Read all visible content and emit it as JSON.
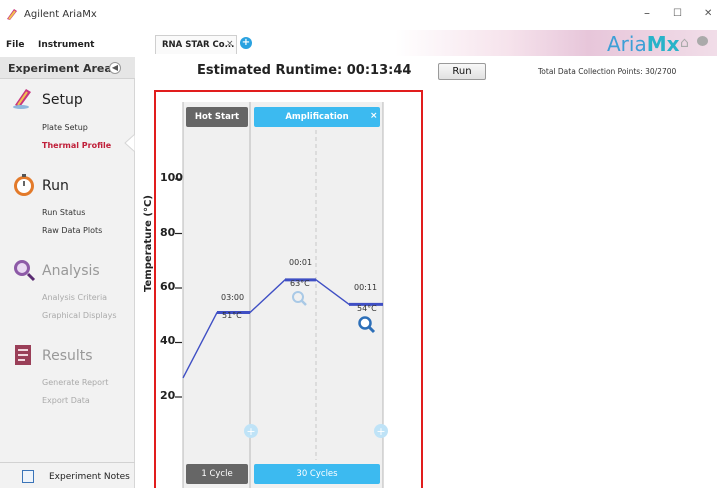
{
  "window": {
    "title": "Agilent AriaMx",
    "minimize": "–",
    "maximize": "☐",
    "close": "✕"
  },
  "menu": {
    "file": "File",
    "instrument": "Instrument"
  },
  "tabs": [
    {
      "label": "RNA STAR Co...",
      "close": "×"
    }
  ],
  "brand": {
    "aria": "Aria",
    "mx": "Mx"
  },
  "sidebar": {
    "header": "Experiment Area",
    "sections": [
      {
        "title": "Setup",
        "icon": "setup-icon",
        "items": [
          "Plate Setup",
          "Thermal Profile"
        ],
        "active": "Thermal Profile"
      },
      {
        "title": "Run",
        "icon": "stopwatch-icon",
        "items": [
          "Run Status",
          "Raw Data Plots"
        ]
      },
      {
        "title": "Analysis",
        "icon": "analysis-icon",
        "items": [
          "Analysis Criteria",
          "Graphical Displays"
        ]
      },
      {
        "title": "Results",
        "icon": "results-icon",
        "items": [
          "Generate Report",
          "Export Data"
        ]
      }
    ],
    "notes": "Experiment Notes"
  },
  "main": {
    "runtime": "Estimated Runtime: 00:13:44",
    "run_button": "Run",
    "collection_points": "Total Data Collection Points: 30/2700"
  },
  "profile": {
    "y_axis_label": "Temperature (°C)",
    "y_ticks": [
      "100",
      "80",
      "60",
      "40",
      "20"
    ],
    "y_range": [
      0,
      120
    ],
    "start_temp": 27,
    "stages": [
      {
        "name": "Hot Start",
        "cycles": "1 Cycle",
        "color": "#666666",
        "steps": [
          {
            "time": "03:00",
            "temp_label": "51°C",
            "temp": 51
          }
        ]
      },
      {
        "name": "Amplification",
        "cycles": "30 Cycles",
        "color": "#3cbaf0",
        "close": "×",
        "steps": [
          {
            "time": "00:01",
            "temp_label": "63°C",
            "temp": 63
          },
          {
            "time": "00:11",
            "temp_label": "54°C",
            "temp": 54
          }
        ]
      }
    ],
    "accent": "#3f4fc4"
  }
}
